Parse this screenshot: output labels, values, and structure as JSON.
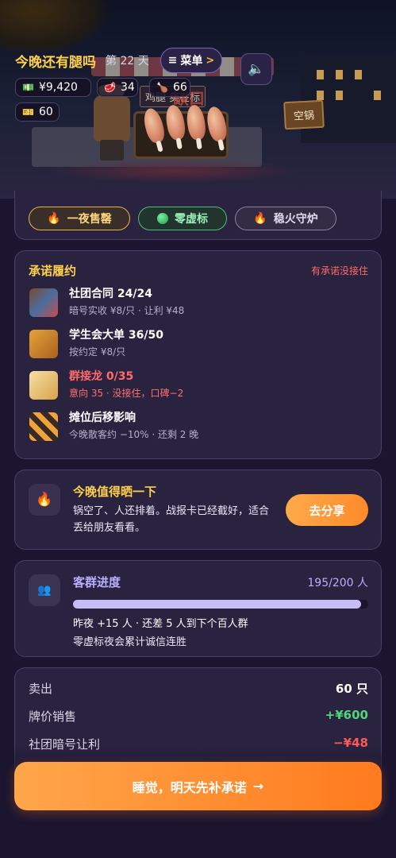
{
  "hud": {
    "title": "今晚还有腿吗",
    "day": "第 22 天",
    "menu_label": "菜单",
    "menu_icon": "hamburger-icon",
    "menu_arrow": ">",
    "sound_icon": "speaker-icon",
    "money": "¥9,420",
    "stock": "34",
    "drumsticks": "66",
    "tickets": "60"
  },
  "scene": {
    "sign": "缺口",
    "sign_tag": "鸡腿 卖在标",
    "empty_pot": "空锅"
  },
  "tags": [
    {
      "icon": "fire-icon",
      "label": "一夜售罄"
    },
    {
      "icon": "green-dot-icon",
      "label": "零虚标"
    },
    {
      "icon": "fire-icon",
      "label": "稳火守炉"
    }
  ],
  "promises": {
    "title": "承诺履约",
    "warning": "有承诺没接住",
    "items": [
      {
        "icon": "sneaker-icon",
        "name": "社团合同 24/24",
        "sub": "暗号实收 ¥8/只 · 让利 ¥48",
        "alert": false
      },
      {
        "icon": "crate-icon",
        "name": "学生会大单 36/50",
        "sub": "按约定 ¥8/只",
        "alert": false
      },
      {
        "icon": "notepad-icon",
        "name": "群接龙 0/35",
        "sub": "意向 35 · 没接住，口碑−2",
        "alert": true
      },
      {
        "icon": "barrier-icon",
        "name": "摊位后移影响",
        "sub": "今晚散客约 −10% · 还剩 2 晚",
        "alert": false
      }
    ]
  },
  "share": {
    "icon": "fire-icon",
    "title": "今晚值得晒一下",
    "desc": "锅空了、人还排着。战报卡已经截好，适合丢给朋友看看。",
    "button": "去分享"
  },
  "group": {
    "icon": "people-icon",
    "title": "客群进度",
    "count": "195/200 人",
    "progress": 0.975,
    "line1": "昨夜 +15 人 · 还差 5 人到下个百人群",
    "line2": "零虚标夜会累计诚信连胜"
  },
  "sales": [
    {
      "label": "卖出",
      "value": "60 只",
      "tone": "white"
    },
    {
      "label": "牌价销售",
      "value": "+¥600",
      "tone": "green"
    },
    {
      "label": "社团暗号让利",
      "value": "−¥48",
      "tone": "red"
    }
  ],
  "action": {
    "label": "睡觉，明天先补承诺",
    "arrow": "→"
  },
  "colors": {
    "accent_gold": "#ffd04a",
    "accent_purple": "#b8b0ff",
    "alert_red": "#ff6a6a",
    "positive_green": "#4fd67c",
    "cta_orange": "#ff8a2a",
    "background": "#1b1530"
  }
}
